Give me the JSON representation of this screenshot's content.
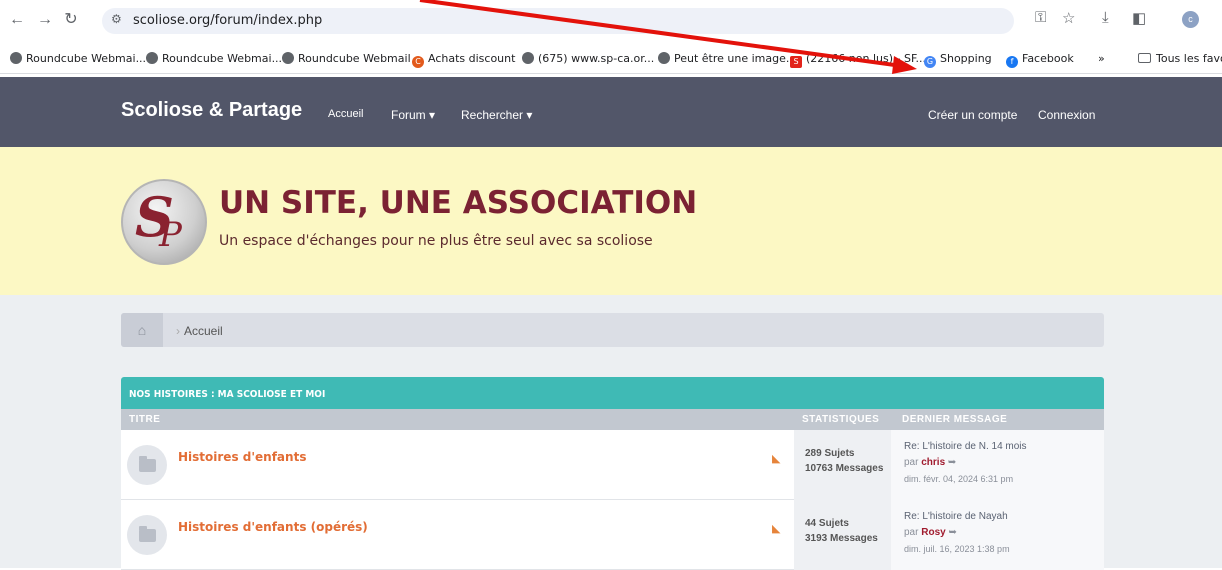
{
  "browser": {
    "url": "scoliose.org/forum/index.php",
    "bookmarks": [
      {
        "label": "Roundcube Webmai...",
        "color": "#5f6368"
      },
      {
        "label": "Roundcube Webmai...",
        "color": "#5f6368"
      },
      {
        "label": "Roundcube Webmail",
        "color": "#5f6368"
      },
      {
        "label": "Achats discount",
        "color": "#e25a1c"
      },
      {
        "label": "(675) www.sp-ca.or...",
        "color": "#5f6368"
      },
      {
        "label": "Peut être une image...",
        "color": "#5f6368"
      },
      {
        "label": "(22166 non lus) - SF...",
        "color": "#e2231a"
      },
      {
        "label": "Shopping",
        "color": "#4285f4"
      },
      {
        "label": "Facebook",
        "color": "#1877f2"
      },
      {
        "label": "Tous les favo",
        "color": "#5f6368"
      }
    ],
    "more_label": "»"
  },
  "site": {
    "brand": "Scoliose & Partage",
    "nav": {
      "accueil": "Accueil",
      "forum": "Forum ▾",
      "rechercher": "Rechercher ▾"
    },
    "account": {
      "register": "Créer un compte",
      "login": "Connexion"
    },
    "hero_title": "UN SITE, UNE ASSOCIATION",
    "hero_sub": "Un espace d'échanges pour ne plus être seul avec sa scoliose",
    "breadcrumb": "Accueil"
  },
  "forum": {
    "section_title": "NOS HISTOIRES : MA SCOLIOSE ET MOI",
    "col_title": "TITRE",
    "col_stats": "STATISTIQUES",
    "col_last": "DERNIER MESSAGE",
    "rows": [
      {
        "title": "Histoires d'enfants",
        "topics": "289 Sujets",
        "messages": "10763 Messages",
        "last_title": "Re: L'histoire de N. 14 mois",
        "last_by_prefix": "par",
        "last_author": "chris",
        "last_date": "dim. févr. 04, 2024 6:31 pm"
      },
      {
        "title": "Histoires d'enfants (opérés)",
        "topics": "44 Sujets",
        "messages": "3193 Messages",
        "last_title": "Re: L'histoire de Nayah",
        "last_by_prefix": "par",
        "last_author": "Rosy",
        "last_date": "dim. juil. 16, 2023 1:38 pm"
      }
    ]
  },
  "colors": {
    "nav_bg": "#525669",
    "hero_bg": "#fcf8c4",
    "accent": "#3fbab5",
    "title_color": "#7b2233",
    "annotation_arrow": "#e3120b"
  }
}
